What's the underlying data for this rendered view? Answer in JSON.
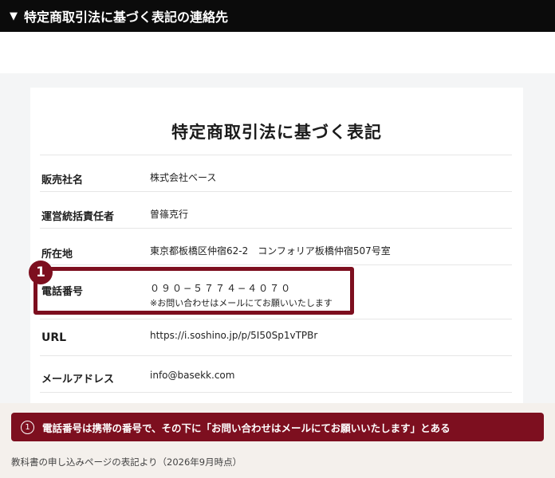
{
  "header": {
    "title": "特定商取引法に基づく表記の連絡先"
  },
  "card": {
    "title": "特定商取引法に基づく表記",
    "rows": [
      {
        "label": "販売社名",
        "value": "株式会社ベース"
      },
      {
        "label": "運営統括責任者",
        "value": "曽篠克行"
      },
      {
        "label": "所在地",
        "value": "東京都板橋区仲宿62-2　コンフォリア板橋仲宿507号室"
      },
      {
        "label": "電話番号",
        "value": "０９０−５７７４−４０７０",
        "note": "※お問い合わせはメールにてお願いいたします"
      },
      {
        "label": "URL",
        "value": "https://i.soshino.jp/p/5I50Sp1vTPBr"
      },
      {
        "label": "メールアドレス",
        "value": "info@basekk.com"
      }
    ]
  },
  "highlight": {
    "number": "1",
    "color": "#7d0f1f"
  },
  "caption": {
    "number": "1",
    "text": "電話番号は携帯の番号で、その下に「お問い合わせはメールにてお願いいたします」とある"
  },
  "source": "教科書の申し込みページの表記より（2026年9月時点）"
}
